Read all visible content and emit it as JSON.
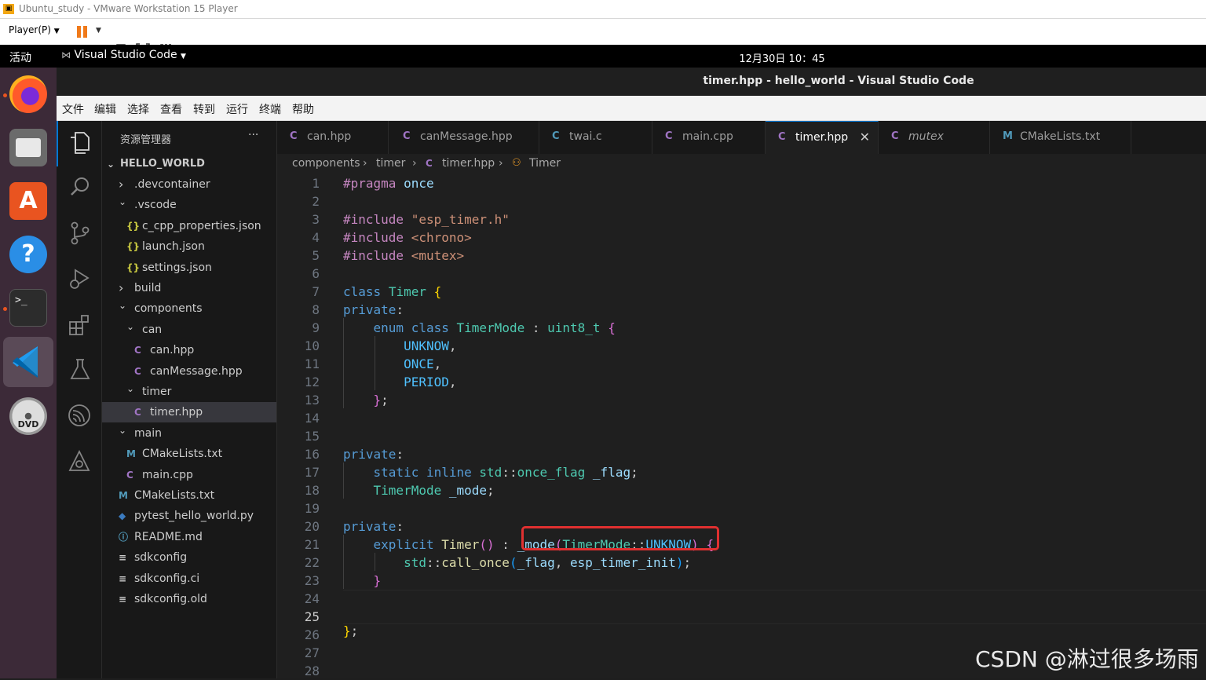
{
  "vm": {
    "title": "Ubuntu_study - VMware Workstation 15 Player",
    "player_menu": "Player(P)"
  },
  "ubuntu": {
    "activities": "活动",
    "app_menu": "Visual Studio Code",
    "clock": "12月30日  10：45"
  },
  "vscode": {
    "window_title": "timer.hpp - hello_world - Visual Studio Code",
    "menu": [
      "文件",
      "编辑",
      "选择",
      "查看",
      "转到",
      "运行",
      "终端",
      "帮助"
    ],
    "explorer_title": "资源管理器",
    "explorer_more": "···",
    "project": "HELLO_WORLD",
    "tree": [
      {
        "label": ".devcontainer",
        "icon": "chevron-right",
        "kind": "folder"
      },
      {
        "label": ".vscode",
        "icon": "chevron-down",
        "kind": "folder"
      },
      {
        "label": "c_cpp_properties.json",
        "icon": "json",
        "kind": "file"
      },
      {
        "label": "launch.json",
        "icon": "json",
        "kind": "file"
      },
      {
        "label": "settings.json",
        "icon": "json",
        "kind": "file"
      },
      {
        "label": "build",
        "icon": "chevron-right",
        "kind": "folder"
      },
      {
        "label": "components",
        "icon": "chevron-down",
        "kind": "folder"
      },
      {
        "label": "can",
        "icon": "chevron-down",
        "kind": "folder"
      },
      {
        "label": "can.hpp",
        "icon": "cpp",
        "kind": "file"
      },
      {
        "label": "canMessage.hpp",
        "icon": "cpp",
        "kind": "file"
      },
      {
        "label": "timer",
        "icon": "chevron-down",
        "kind": "folder"
      },
      {
        "label": "timer.hpp",
        "icon": "cpp",
        "kind": "file",
        "selected": true
      },
      {
        "label": "main",
        "icon": "chevron-down",
        "kind": "folder"
      },
      {
        "label": "CMakeLists.txt",
        "icon": "cmake",
        "kind": "file"
      },
      {
        "label": "main.cpp",
        "icon": "cpp",
        "kind": "file"
      },
      {
        "label": "CMakeLists.txt",
        "icon": "cmake",
        "kind": "file"
      },
      {
        "label": "pytest_hello_world.py",
        "icon": "python",
        "kind": "file"
      },
      {
        "label": "README.md",
        "icon": "info",
        "kind": "file"
      },
      {
        "label": "sdkconfig",
        "icon": "lines",
        "kind": "file"
      },
      {
        "label": "sdkconfig.ci",
        "icon": "lines",
        "kind": "file"
      },
      {
        "label": "sdkconfig.old",
        "icon": "lines",
        "kind": "file"
      }
    ],
    "tabs": [
      {
        "label": "can.hpp",
        "icon": "cpp"
      },
      {
        "label": "canMessage.hpp",
        "icon": "cpp"
      },
      {
        "label": "twai.c",
        "icon": "c"
      },
      {
        "label": "main.cpp",
        "icon": "cpp"
      },
      {
        "label": "timer.hpp",
        "icon": "cpp",
        "active": true,
        "close": "✕"
      },
      {
        "label": "mutex",
        "icon": "cpp",
        "italic": true
      },
      {
        "label": "CMakeLists.txt",
        "icon": "cmake"
      }
    ],
    "breadcrumb": [
      "components",
      "timer",
      "timer.hpp",
      "Timer"
    ],
    "current_line": 25,
    "line_count": 28
  },
  "watermark": "CSDN @淋过很多场雨",
  "colors": {
    "accent": "#0078d4",
    "highlight_box": "#e03030",
    "editor_bg": "#1f1f1f",
    "dock_bg": "#3c2a38"
  }
}
